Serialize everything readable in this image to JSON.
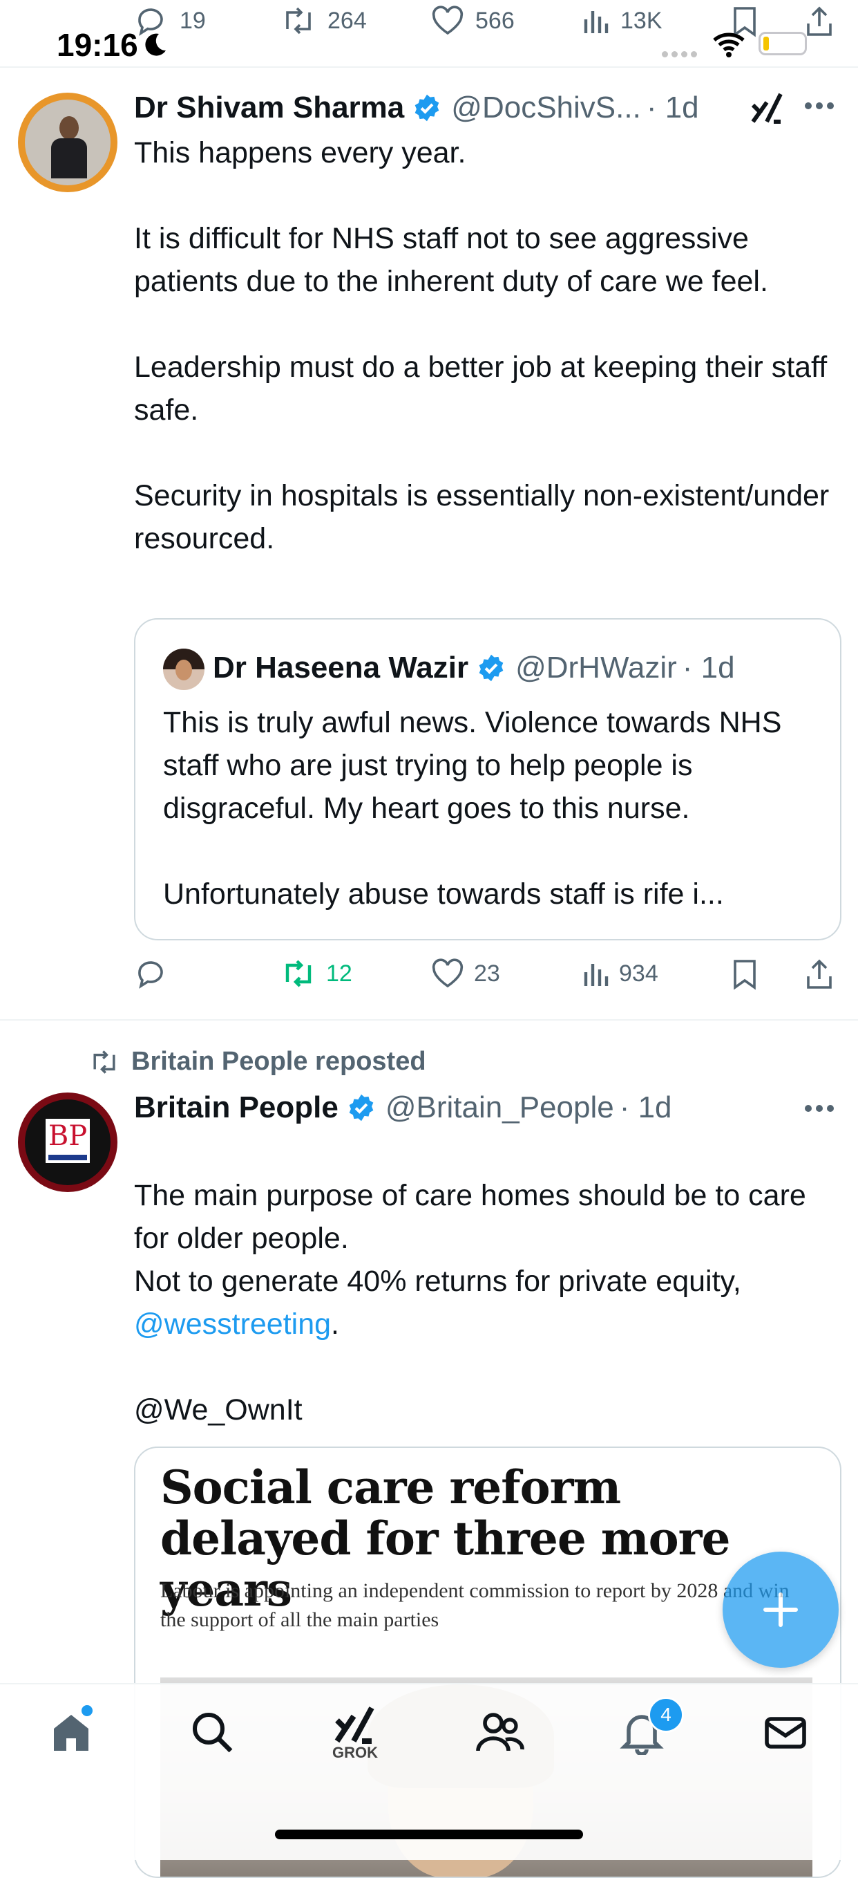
{
  "status_bar": {
    "time": "19:16"
  },
  "top_metrics": {
    "replies": "19",
    "reposts": "264",
    "likes": "566",
    "views": "13K"
  },
  "tweet1": {
    "author": "Dr Shivam Sharma",
    "handle": "@DocShivS...",
    "time": "· 1d",
    "text": "This happens every year.\n\nIt is difficult for NHS staff not to see aggressive patients due to the inherent duty of care we feel.\n\nLeadership must do a better job at keeping their staff safe.\n\nSecurity in hospitals is essentially non-existent/under resourced.",
    "quote": {
      "author": "Dr Haseena Wazir",
      "handle": "@DrHWazir",
      "time": "· 1d",
      "text": "This is truly awful news. Violence towards NHS staff who are just trying to help people is disgraceful. My heart goes to this nurse.\n\nUnfortunately abuse towards staff is rife i..."
    },
    "actions": {
      "reposts": "12",
      "likes": "23",
      "views": "934"
    }
  },
  "tweet2": {
    "repost_label": "Britain People reposted",
    "author": "Britain People",
    "handle": "@Britain_People",
    "time": "· 1d",
    "avatar_text": "BP",
    "text_line1": "The main purpose of care homes should be to care for older people.",
    "text_line2_prefix": "Not to generate 40% returns for private equity, ",
    "mention1": "@wesstreeting",
    "text_line2_suffix": ".",
    "mention2": "@We_OwnIt",
    "article": {
      "headline": "Social care reform delayed for three more years",
      "subhead": "Labour is appointing an independent commission to report by 2028 and win the support of all the main parties"
    }
  },
  "nav": {
    "grok_label": "GROK",
    "notifications_badge": "4"
  },
  "colors": {
    "accent": "#1d9bf0",
    "repost_green": "#00ba7c",
    "muted": "#536471"
  }
}
